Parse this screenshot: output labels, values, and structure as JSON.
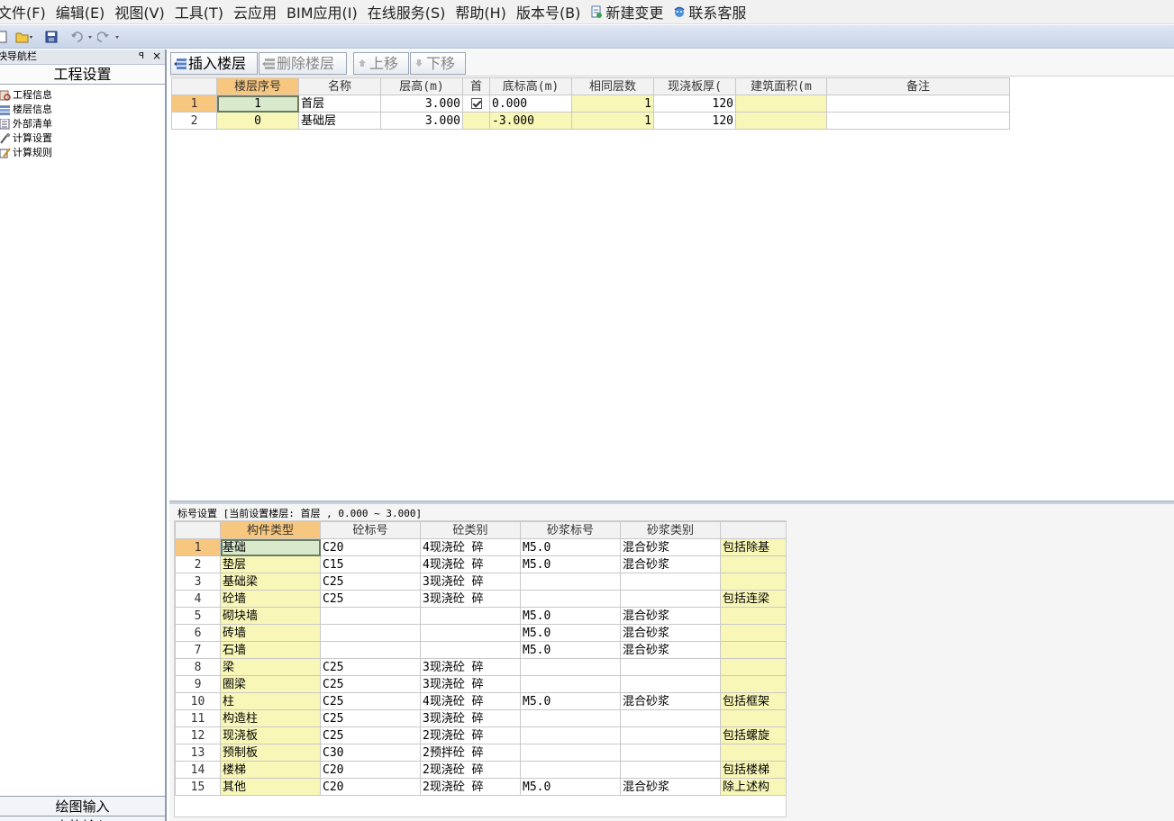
{
  "menu": [
    "文件(F)",
    "编辑(E)",
    "视图(V)",
    "工具(T)",
    "云应用",
    "BIM应用(I)",
    "在线服务(S)",
    "帮助(H)",
    "版本号(B)",
    "新建变更",
    "联系客服"
  ],
  "nav": {
    "header": "快导航栏",
    "pin": "ꟼ",
    "close": "×",
    "title": "工程设置",
    "items": [
      "工程信息",
      "楼层信息",
      "外部清单",
      "计算设置",
      "计算规则"
    ],
    "bottom": [
      "绘图输入",
      "表格输入"
    ]
  },
  "floor_toolbar": {
    "insert": "插入楼层",
    "delete": "删除楼层",
    "up": "上移",
    "down": "下移"
  },
  "floors": {
    "headers": [
      "",
      "楼层序号",
      "名称",
      "层高(m)",
      "首",
      "底标高(m)",
      "相同层数",
      "现浇板厚(",
      "建筑面积(m",
      "备注"
    ],
    "rows": [
      {
        "rn": "1",
        "seq": "1",
        "name": "首层",
        "height": "3.000",
        "first": true,
        "bottom": "0.000",
        "same": "1",
        "slab": "120",
        "area": "",
        "note": ""
      },
      {
        "rn": "2",
        "seq": "0",
        "name": "基础层",
        "height": "3.000",
        "first": false,
        "bottom": "-3.000",
        "same": "1",
        "slab": "120",
        "area": "",
        "note": ""
      }
    ]
  },
  "grade": {
    "title": "标号设置 [当前设置楼层: 首层 , 0.000 ~ 3.000]",
    "headers": [
      "",
      "构件类型",
      "砼标号",
      "砼类别",
      "砂浆标号",
      "砂浆类别",
      ""
    ],
    "rows": [
      {
        "rn": "1",
        "type": "基础",
        "concrete": "C20",
        "ccat": "4现浇砼 碎",
        "mortar": "M5.0",
        "mcat": "混合砂浆",
        "note": "包括除基"
      },
      {
        "rn": "2",
        "type": "垫层",
        "concrete": "C15",
        "ccat": "4现浇砼 碎",
        "mortar": "M5.0",
        "mcat": "混合砂浆",
        "note": ""
      },
      {
        "rn": "3",
        "type": "基础梁",
        "concrete": "C25",
        "ccat": "3现浇砼 碎",
        "mortar": "",
        "mcat": "",
        "note": ""
      },
      {
        "rn": "4",
        "type": "砼墙",
        "concrete": "C25",
        "ccat": "3现浇砼 碎",
        "mortar": "",
        "mcat": "",
        "note": "包括连梁"
      },
      {
        "rn": "5",
        "type": "砌块墙",
        "concrete": "",
        "ccat": "",
        "mortar": "M5.0",
        "mcat": "混合砂浆",
        "note": ""
      },
      {
        "rn": "6",
        "type": "砖墙",
        "concrete": "",
        "ccat": "",
        "mortar": "M5.0",
        "mcat": "混合砂浆",
        "note": ""
      },
      {
        "rn": "7",
        "type": "石墙",
        "concrete": "",
        "ccat": "",
        "mortar": "M5.0",
        "mcat": "混合砂浆",
        "note": ""
      },
      {
        "rn": "8",
        "type": "梁",
        "concrete": "C25",
        "ccat": "3现浇砼 碎",
        "mortar": "",
        "mcat": "",
        "note": ""
      },
      {
        "rn": "9",
        "type": "圈梁",
        "concrete": "C25",
        "ccat": "3现浇砼 碎",
        "mortar": "",
        "mcat": "",
        "note": ""
      },
      {
        "rn": "10",
        "type": "柱",
        "concrete": "C25",
        "ccat": "4现浇砼 碎",
        "mortar": "M5.0",
        "mcat": "混合砂浆",
        "note": "包括框架"
      },
      {
        "rn": "11",
        "type": "构造柱",
        "concrete": "C25",
        "ccat": "3现浇砼 碎",
        "mortar": "",
        "mcat": "",
        "note": ""
      },
      {
        "rn": "12",
        "type": "现浇板",
        "concrete": "C25",
        "ccat": "2现浇砼 碎",
        "mortar": "",
        "mcat": "",
        "note": "包括螺旋"
      },
      {
        "rn": "13",
        "type": "预制板",
        "concrete": "C30",
        "ccat": "2预拌砼 碎",
        "mortar": "",
        "mcat": "",
        "note": ""
      },
      {
        "rn": "14",
        "type": "楼梯",
        "concrete": "C20",
        "ccat": "2现浇砼 碎",
        "mortar": "",
        "mcat": "",
        "note": "包括楼梯"
      },
      {
        "rn": "15",
        "type": "其他",
        "concrete": "C20",
        "ccat": "2现浇砼 碎",
        "mortar": "M5.0",
        "mcat": "混合砂浆",
        "note": "除上述构"
      }
    ]
  }
}
